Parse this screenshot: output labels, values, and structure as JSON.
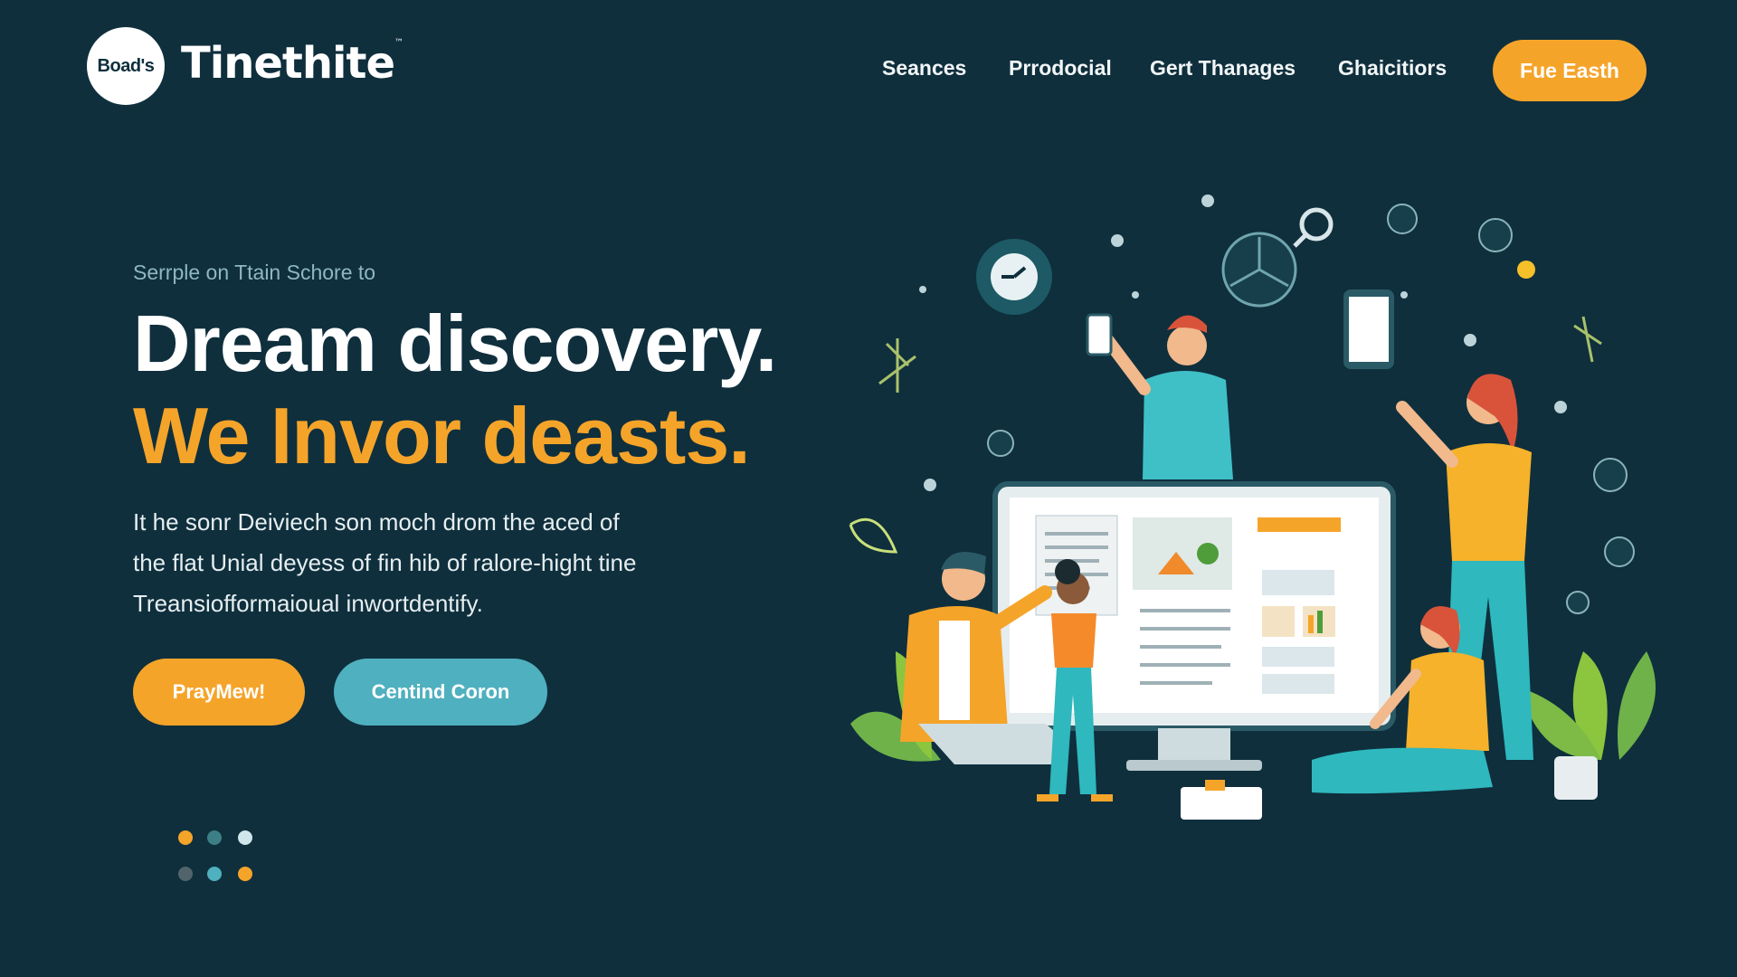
{
  "header": {
    "logo_text": "Boad's",
    "brand": "Tinethite",
    "brand_tm": "™",
    "nav": [
      "Seances",
      "Prrodocial",
      "Gert Thanages",
      "Ghaicitiors"
    ],
    "cta": "Fue Easth"
  },
  "hero": {
    "eyebrow": "Serrple on Ttain Schore to",
    "headline_1": "Dream discovery.",
    "headline_2": "We Invor deasts.",
    "paragraph_lines": [
      "It he sonr Deiviech son moch drom the aced of",
      "the flat Unial deyess of fin hib of ralore-hight tine",
      "Treansiofformaioual inwortdentify."
    ],
    "primary_button": "PrayMew!",
    "secondary_button": "Centind Coron"
  },
  "colors": {
    "background": "#0f2f3d",
    "accent_orange": "#f5a42a",
    "accent_teal": "#4fb0bf"
  },
  "carousel_dots": [
    "orange",
    "teal",
    "light",
    "gray",
    "teal",
    "orange"
  ],
  "illustration": {
    "name": "team-collaboration-illustration"
  }
}
